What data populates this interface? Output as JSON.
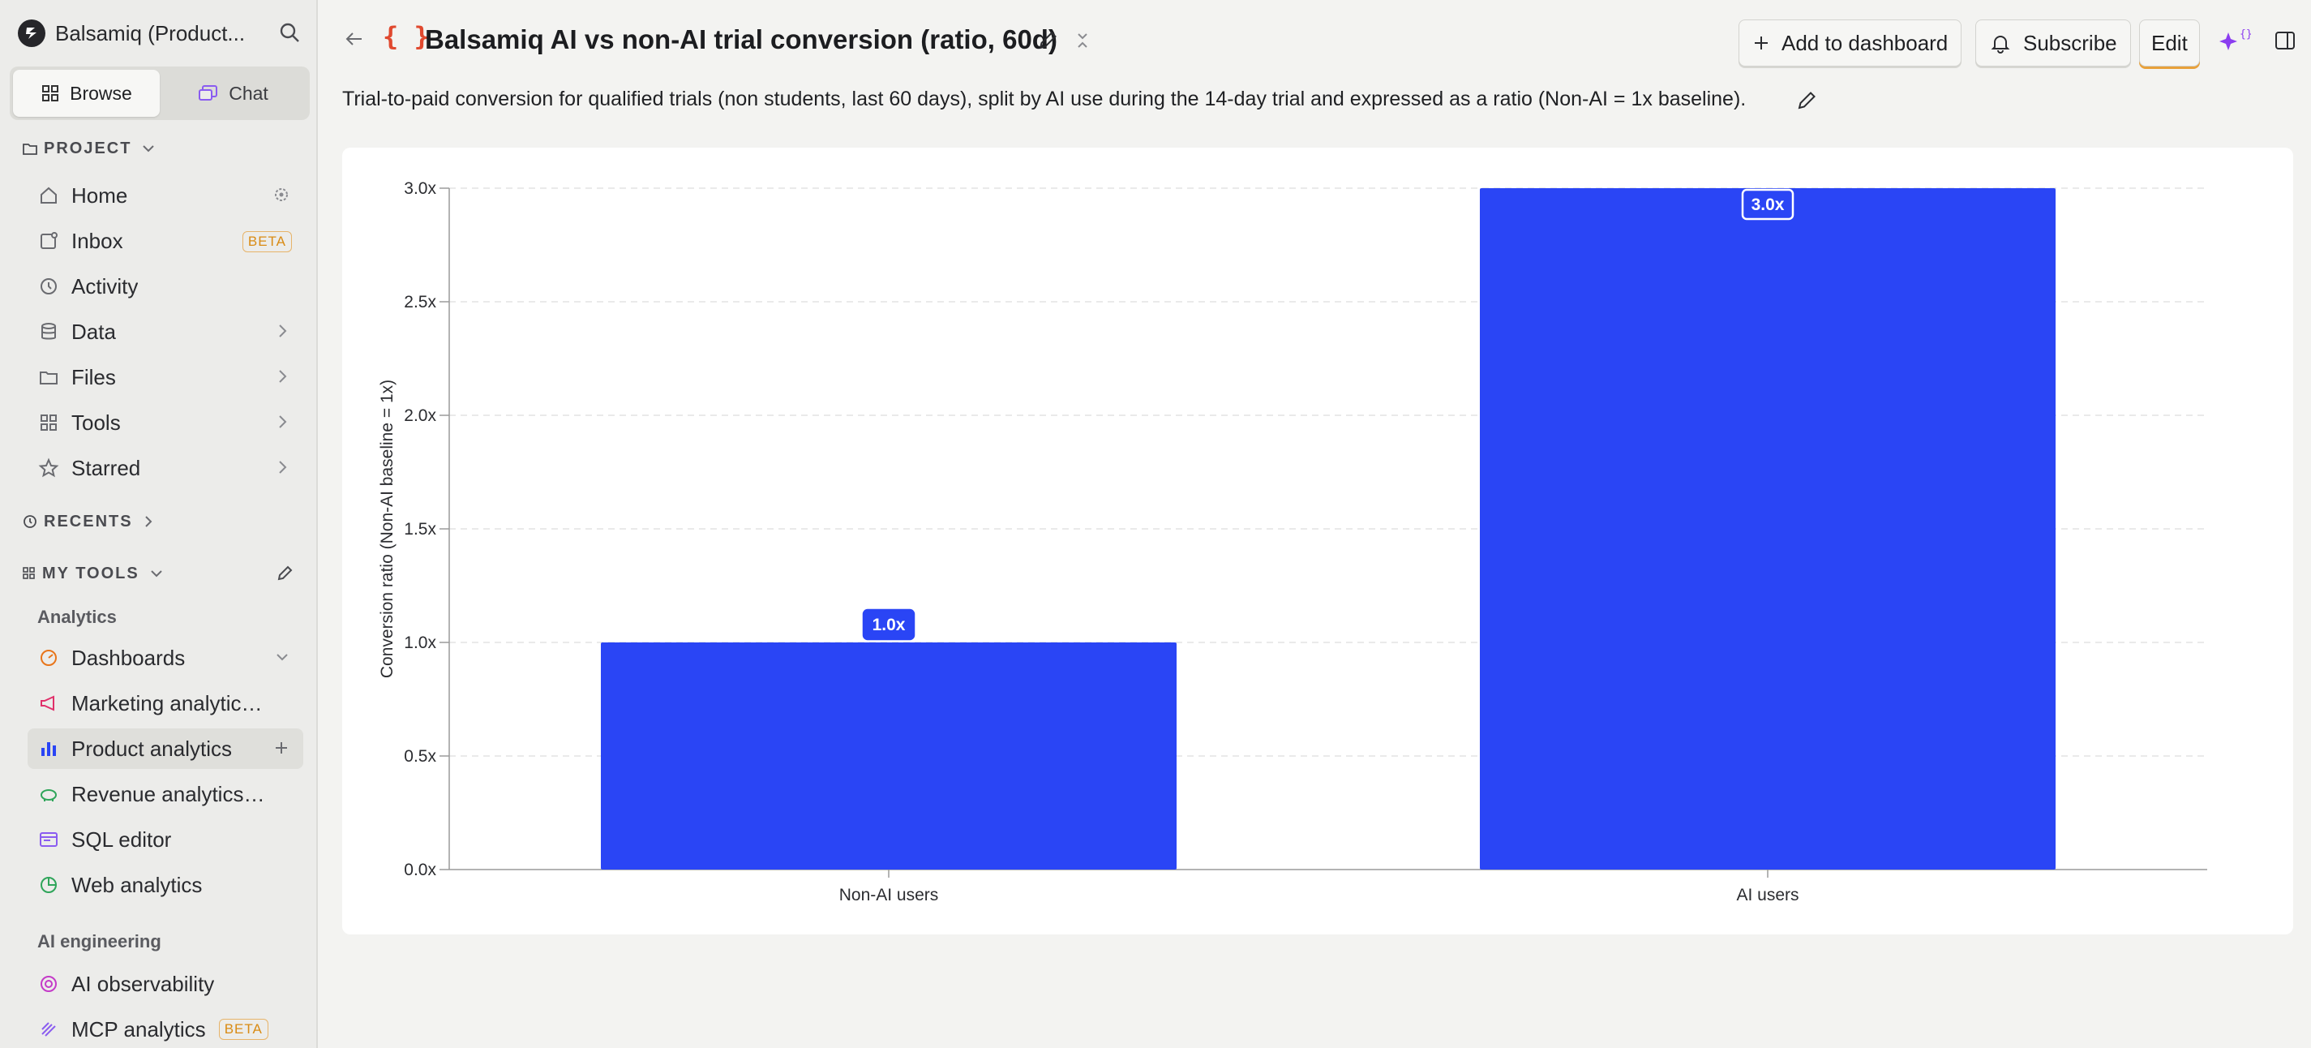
{
  "sidebar": {
    "org_name": "Balsamiq (Product...",
    "modes": [
      {
        "label": "Browse",
        "active": true
      },
      {
        "label": "Chat",
        "active": false
      }
    ],
    "project_label": "PROJECT",
    "project_items": [
      {
        "label": "Home",
        "icon": "home-icon"
      },
      {
        "label": "Inbox",
        "icon": "inbox-icon",
        "badge": "BETA"
      },
      {
        "label": "Activity",
        "icon": "clock-icon"
      },
      {
        "label": "Data",
        "icon": "database-icon"
      },
      {
        "label": "Files",
        "icon": "folder-icon"
      },
      {
        "label": "Tools",
        "icon": "grid-icon"
      },
      {
        "label": "Starred",
        "icon": "star-icon"
      }
    ],
    "recents_label": "RECENTS",
    "my_tools_label": "MY TOOLS",
    "analytics_group": "Analytics",
    "analytics_items": [
      {
        "label": "Dashboards",
        "icon": "dashboard-icon"
      },
      {
        "label": "Marketing analytics ...",
        "icon": "megaphone-icon"
      },
      {
        "label": "Product analytics",
        "icon": "bar-chart-icon"
      },
      {
        "label": "Revenue analytics ...",
        "icon": "piggy-bank-icon"
      },
      {
        "label": "SQL editor",
        "icon": "sql-icon"
      },
      {
        "label": "Web analytics",
        "icon": "pie-icon"
      }
    ],
    "ai_group": "AI engineering",
    "ai_items": [
      {
        "label": "AI observability",
        "icon": "observability-icon"
      },
      {
        "label": "MCP analytics",
        "icon": "mcp-icon",
        "badge": "BETA"
      }
    ]
  },
  "header": {
    "query_icon": "{ }",
    "title": "Balsamiq AI vs non-AI trial conversion (ratio, 60d)",
    "add_to_dashboard": "Add to dashboard",
    "subscribe": "Subscribe",
    "edit": "Edit"
  },
  "description": "Trial-to-paid conversion for qualified trials (non students, last 60 days), split by AI use during the 14-day trial and expressed as a ratio (Non-AI = 1x baseline).",
  "colors": {
    "bar": "#2a45f5",
    "accent": "#e8a13a"
  },
  "chart_data": {
    "type": "bar",
    "categories": [
      "Non-AI users",
      "AI users"
    ],
    "values": [
      1.0,
      3.0
    ],
    "data_labels": [
      "1.0x",
      "3.0x"
    ],
    "ylabel": "Conversion ratio (Non-AI baseline = 1x)",
    "xlabel": "",
    "ylim": [
      0,
      3.0
    ],
    "yticks": [
      0,
      0.5,
      1.0,
      1.5,
      2.0,
      2.5,
      3.0
    ],
    "ytick_labels": [
      "0.0x",
      "0.5x",
      "1.0x",
      "1.5x",
      "2.0x",
      "2.5x",
      "3.0x"
    ],
    "grid": true,
    "legend": "none"
  }
}
